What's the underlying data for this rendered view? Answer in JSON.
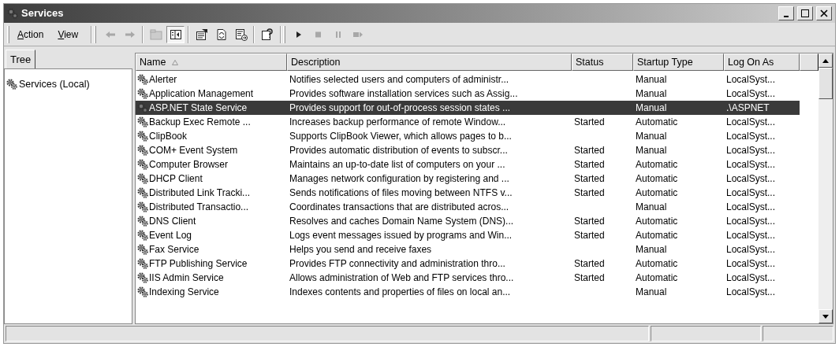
{
  "window": {
    "title": "Services"
  },
  "menu": [
    {
      "label": "Action"
    },
    {
      "label": "View"
    }
  ],
  "toolbar": [
    {
      "kind": "back",
      "disabled": true,
      "pressed": false
    },
    {
      "kind": "forward",
      "disabled": true,
      "pressed": false
    },
    {
      "kind": "sep"
    },
    {
      "kind": "up",
      "disabled": true,
      "pressed": false
    },
    {
      "kind": "tree",
      "disabled": false,
      "pressed": true
    },
    {
      "kind": "sep"
    },
    {
      "kind": "properties",
      "disabled": false,
      "pressed": false
    },
    {
      "kind": "refresh",
      "disabled": false,
      "pressed": false
    },
    {
      "kind": "export",
      "disabled": false,
      "pressed": false
    },
    {
      "kind": "sep"
    },
    {
      "kind": "help",
      "disabled": false,
      "pressed": false
    },
    {
      "kind": "bar"
    },
    {
      "kind": "start",
      "disabled": false,
      "pressed": false
    },
    {
      "kind": "stop",
      "disabled": true,
      "pressed": false
    },
    {
      "kind": "pause",
      "disabled": true,
      "pressed": false
    },
    {
      "kind": "restart",
      "disabled": true,
      "pressed": false
    }
  ],
  "tree": {
    "tab": "Tree",
    "items": [
      {
        "label": "Services (Local)",
        "selected": false
      }
    ]
  },
  "table": {
    "columns": [
      {
        "label": "Name",
        "sorted": true
      },
      {
        "label": "Description",
        "sorted": false
      },
      {
        "label": "Status",
        "sorted": false
      },
      {
        "label": "Startup Type",
        "sorted": false
      },
      {
        "label": "Log On As",
        "sorted": false
      }
    ],
    "rows": [
      {
        "name": "Alerter",
        "description": "Notifies selected users and computers of administr...",
        "status": "",
        "startup": "Manual",
        "logon": "LocalSyst...",
        "selected": false
      },
      {
        "name": "Application Management",
        "description": "Provides software installation services such as Assig...",
        "status": "",
        "startup": "Manual",
        "logon": "LocalSyst...",
        "selected": false
      },
      {
        "name": "ASP.NET State Service",
        "description": "Provides support for out-of-process session states ...",
        "status": "",
        "startup": "Manual",
        "logon": ".\\ASPNET",
        "selected": true
      },
      {
        "name": "Backup Exec Remote ...",
        "description": "Increases backup performance of remote Window...",
        "status": "Started",
        "startup": "Automatic",
        "logon": "LocalSyst...",
        "selected": false
      },
      {
        "name": "ClipBook",
        "description": "Supports ClipBook Viewer, which allows pages to b...",
        "status": "",
        "startup": "Manual",
        "logon": "LocalSyst...",
        "selected": false
      },
      {
        "name": "COM+ Event System",
        "description": "Provides automatic distribution of events to subscr...",
        "status": "Started",
        "startup": "Manual",
        "logon": "LocalSyst...",
        "selected": false
      },
      {
        "name": "Computer Browser",
        "description": "Maintains an up-to-date list of computers on your ...",
        "status": "Started",
        "startup": "Automatic",
        "logon": "LocalSyst...",
        "selected": false
      },
      {
        "name": "DHCP Client",
        "description": "Manages network configuration by registering and ...",
        "status": "Started",
        "startup": "Automatic",
        "logon": "LocalSyst...",
        "selected": false
      },
      {
        "name": "Distributed Link Tracki...",
        "description": "Sends notifications of files moving between NTFS v...",
        "status": "Started",
        "startup": "Automatic",
        "logon": "LocalSyst...",
        "selected": false
      },
      {
        "name": "Distributed Transactio...",
        "description": "Coordinates transactions that are distributed acros...",
        "status": "",
        "startup": "Manual",
        "logon": "LocalSyst...",
        "selected": false
      },
      {
        "name": "DNS Client",
        "description": "Resolves and caches Domain Name System (DNS)...",
        "status": "Started",
        "startup": "Automatic",
        "logon": "LocalSyst...",
        "selected": false
      },
      {
        "name": "Event Log",
        "description": "Logs event messages issued by programs and Win...",
        "status": "Started",
        "startup": "Automatic",
        "logon": "LocalSyst...",
        "selected": false
      },
      {
        "name": "Fax Service",
        "description": "Helps you send and receive faxes",
        "status": "",
        "startup": "Manual",
        "logon": "LocalSyst...",
        "selected": false
      },
      {
        "name": "FTP Publishing Service",
        "description": "Provides FTP connectivity and administration thro...",
        "status": "Started",
        "startup": "Automatic",
        "logon": "LocalSyst...",
        "selected": false
      },
      {
        "name": "IIS Admin Service",
        "description": "Allows administration of Web and FTP services thro...",
        "status": "Started",
        "startup": "Automatic",
        "logon": "LocalSyst...",
        "selected": false
      },
      {
        "name": "Indexing Service",
        "description": "Indexes contents and properties of files on local an...",
        "status": "",
        "startup": "Manual",
        "logon": "LocalSyst...",
        "selected": false
      }
    ]
  }
}
